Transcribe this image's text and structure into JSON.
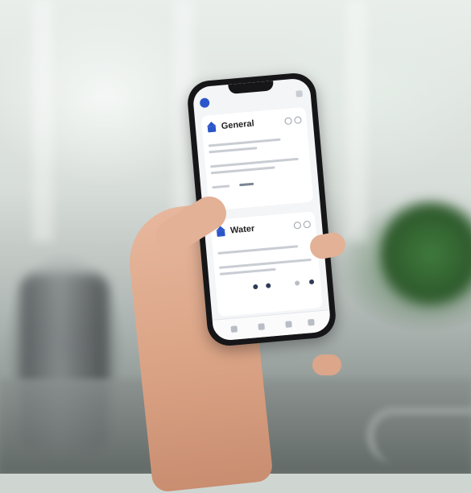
{
  "scene": {
    "description_colors": {
      "accent": "#2b56c9",
      "plant": "#3f7a3c",
      "skin": "#e3b196"
    }
  },
  "phone_app": {
    "card1": {
      "title": "General"
    },
    "card2": {
      "title": "Water"
    }
  },
  "icons": [
    "home-icon",
    "settings-icon",
    "menu-icon"
  ]
}
